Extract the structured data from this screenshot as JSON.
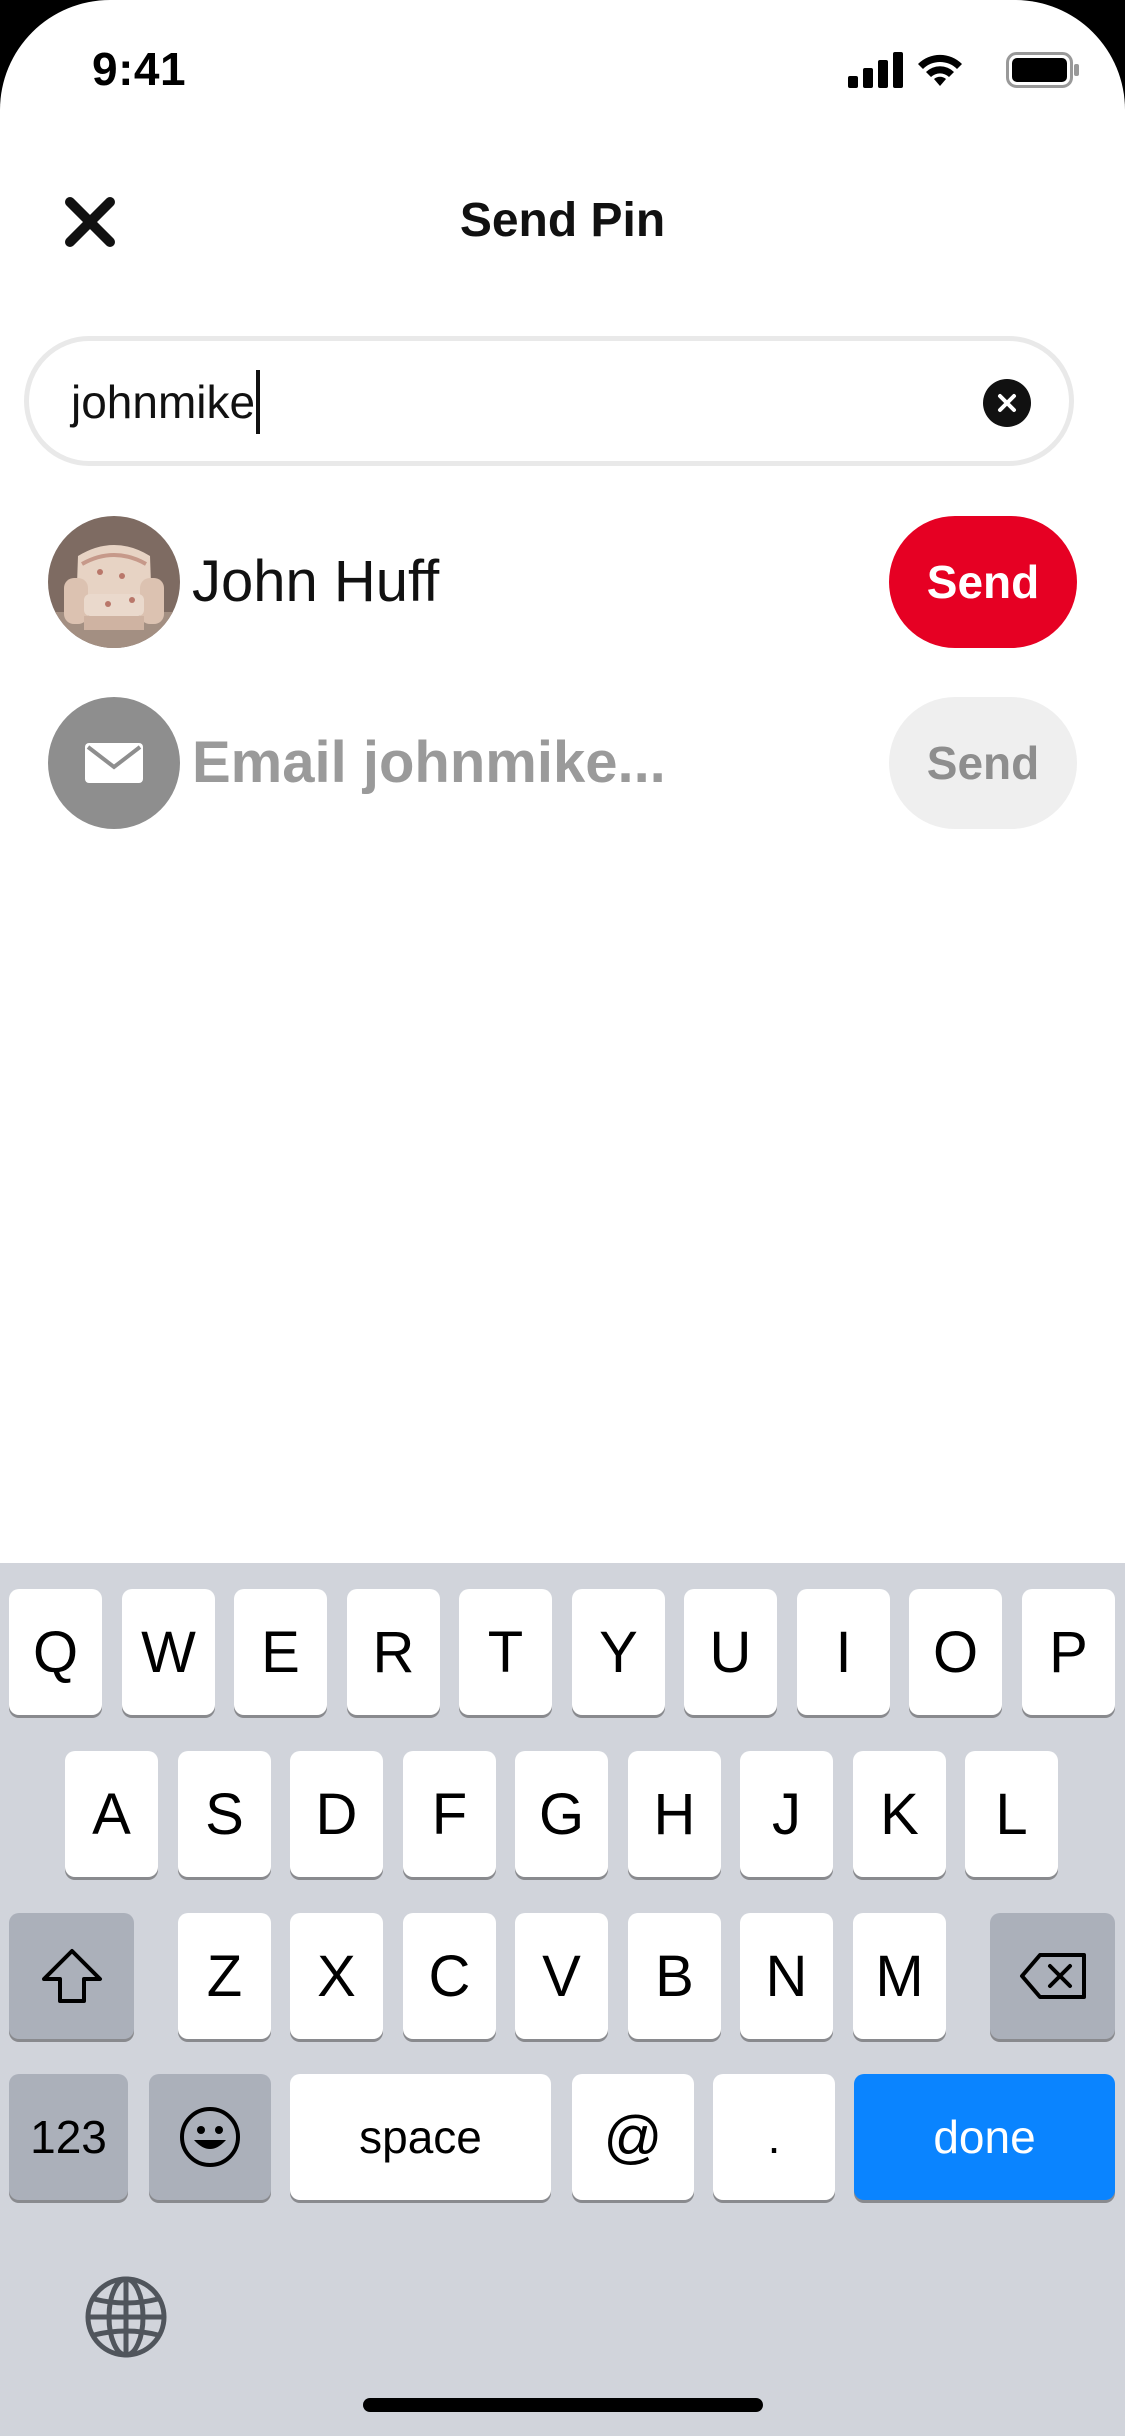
{
  "status_bar": {
    "time": "9:41"
  },
  "header": {
    "title": "Send Pin"
  },
  "search": {
    "value": "johnmike"
  },
  "results": [
    {
      "name": "John Huff",
      "action": "Send"
    },
    {
      "name": "Email johnmike...",
      "action": "Send"
    }
  ],
  "colors": {
    "brand_red": "#e60023",
    "keyboard_blue": "#0a84ff"
  },
  "keyboard": {
    "row1": [
      "Q",
      "W",
      "E",
      "R",
      "T",
      "Y",
      "U",
      "I",
      "O",
      "P"
    ],
    "row2": [
      "A",
      "S",
      "D",
      "F",
      "G",
      "H",
      "J",
      "K",
      "L"
    ],
    "row3": [
      "Z",
      "X",
      "C",
      "V",
      "B",
      "N",
      "M"
    ],
    "numbers": "123",
    "space": "space",
    "at": "@",
    "dot": ".",
    "done": "done"
  }
}
